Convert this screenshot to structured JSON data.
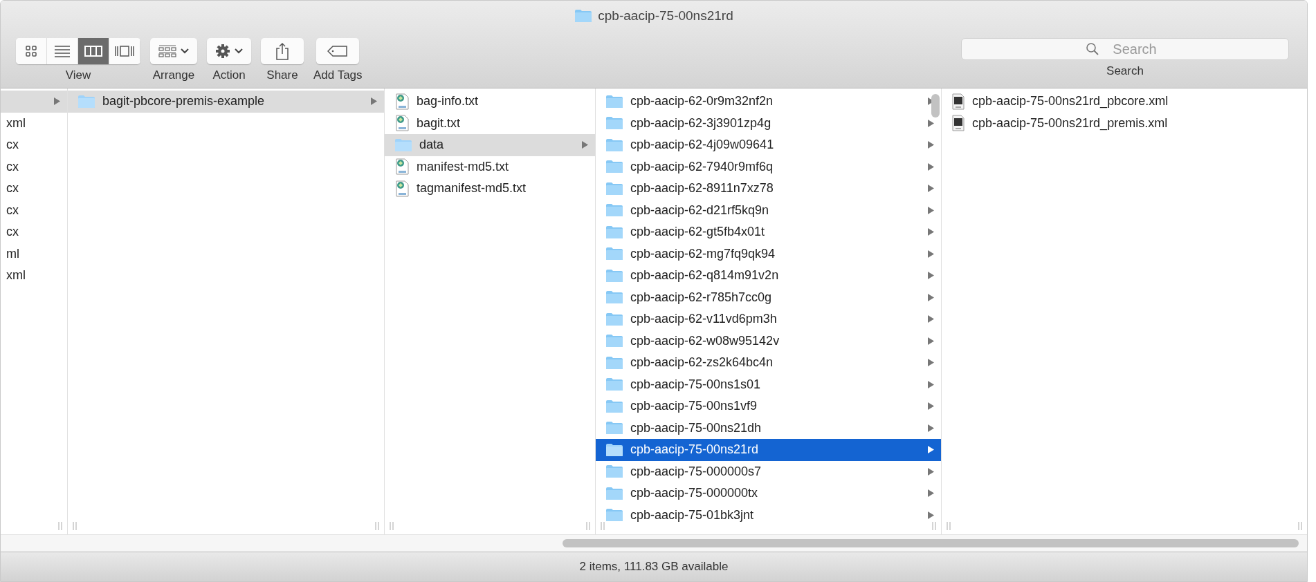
{
  "window": {
    "title": "cpb-aacip-75-00ns21rd"
  },
  "toolbar": {
    "view_modes": [
      {
        "kind": "icons",
        "selected": false
      },
      {
        "kind": "list",
        "selected": false
      },
      {
        "kind": "columns",
        "selected": true
      },
      {
        "kind": "gallery",
        "selected": false
      }
    ],
    "groups": [
      {
        "kind": "view",
        "label": "View"
      },
      {
        "kind": "arrange",
        "label": "Arrange"
      },
      {
        "kind": "action",
        "label": "Action"
      },
      {
        "kind": "share",
        "label": "Share"
      },
      {
        "kind": "tags",
        "label": "Add Tags"
      }
    ],
    "search": {
      "placeholder": "Search",
      "label": "Search"
    }
  },
  "columns": [
    {
      "items": [
        {
          "selected": true,
          "arrow": true
        },
        {
          "name": "xml",
          "selected": false
        },
        {
          "name": "cx",
          "selected": false
        },
        {
          "name": "cx",
          "selected": false
        },
        {
          "name": "cx",
          "selected": false
        },
        {
          "name": "cx",
          "selected": false
        },
        {
          "name": "cx",
          "selected": false
        },
        {
          "name": "ml",
          "selected": false
        },
        {
          "name": "xml",
          "selected": false
        }
      ]
    },
    {
      "items": [
        {
          "name": "bagit-pbcore-premis-example",
          "kind": "folder",
          "selected": true
        }
      ]
    },
    {
      "items": [
        {
          "name": "bag-info.txt",
          "kind": "text",
          "selected": false
        },
        {
          "name": "bagit.txt",
          "kind": "text",
          "selected": false
        },
        {
          "name": "data",
          "kind": "folder",
          "selected": true
        },
        {
          "name": "manifest-md5.txt",
          "kind": "text",
          "selected": false
        },
        {
          "name": "tagmanifest-md5.txt",
          "kind": "text",
          "selected": false
        }
      ]
    },
    {
      "scrollable": true,
      "items": [
        {
          "name": "cpb-aacip-62-0r9m32nf2n",
          "kind": "folder",
          "selected": false
        },
        {
          "name": "cpb-aacip-62-3j3901zp4g",
          "kind": "folder",
          "selected": false
        },
        {
          "name": "cpb-aacip-62-4j09w09641",
          "kind": "folder",
          "selected": false
        },
        {
          "name": "cpb-aacip-62-7940r9mf6q",
          "kind": "folder",
          "selected": false
        },
        {
          "name": "cpb-aacip-62-8911n7xz78",
          "kind": "folder",
          "selected": false
        },
        {
          "name": "cpb-aacip-62-d21rf5kq9n",
          "kind": "folder",
          "selected": false
        },
        {
          "name": "cpb-aacip-62-gt5fb4x01t",
          "kind": "folder",
          "selected": false
        },
        {
          "name": "cpb-aacip-62-mg7fq9qk94",
          "kind": "folder",
          "selected": false
        },
        {
          "name": "cpb-aacip-62-q814m91v2n",
          "kind": "folder",
          "selected": false
        },
        {
          "name": "cpb-aacip-62-r785h7cc0g",
          "kind": "folder",
          "selected": false
        },
        {
          "name": "cpb-aacip-62-v11vd6pm3h",
          "kind": "folder",
          "selected": false
        },
        {
          "name": "cpb-aacip-62-w08w95142v",
          "kind": "folder",
          "selected": false
        },
        {
          "name": "cpb-aacip-62-zs2k64bc4n",
          "kind": "folder",
          "selected": false
        },
        {
          "name": "cpb-aacip-75-00ns1s01",
          "kind": "folder",
          "selected": false
        },
        {
          "name": "cpb-aacip-75-00ns1vf9",
          "kind": "folder",
          "selected": false
        },
        {
          "name": "cpb-aacip-75-00ns21dh",
          "kind": "folder",
          "selected": false
        },
        {
          "name": "cpb-aacip-75-00ns21rd",
          "kind": "folder",
          "selected": true
        },
        {
          "name": "cpb-aacip-75-000000s7",
          "kind": "folder",
          "selected": false
        },
        {
          "name": "cpb-aacip-75-000000tx",
          "kind": "folder",
          "selected": false
        },
        {
          "name": "cpb-aacip-75-01bk3jnt",
          "kind": "folder",
          "selected": false
        }
      ]
    },
    {
      "items": [
        {
          "name": "cpb-aacip-75-00ns21rd_pbcore.xml",
          "kind": "xml",
          "selected": false
        },
        {
          "name": "cpb-aacip-75-00ns21rd_premis.xml",
          "kind": "xml",
          "selected": false
        }
      ]
    }
  ],
  "status_bar": "2 items, 111.83 GB available"
}
